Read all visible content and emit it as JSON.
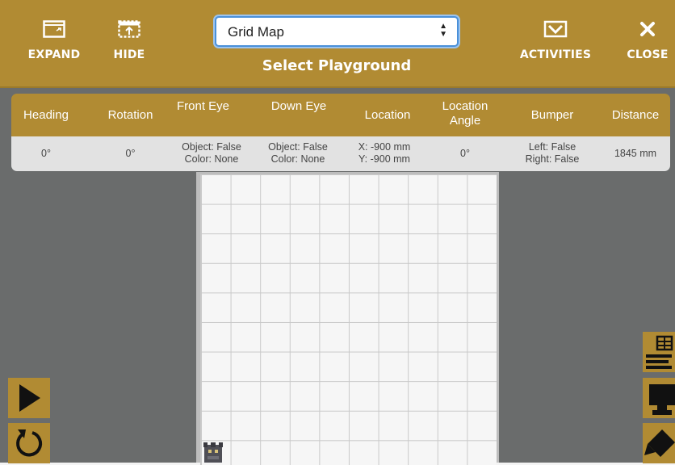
{
  "toolbar": {
    "expand_label": "EXPAND",
    "hide_label": "HIDE",
    "activities_label": "ACTIVITIES",
    "close_label": "CLOSE",
    "title": "Select Playground",
    "playground_select": {
      "value": "Grid Map"
    }
  },
  "sensors": {
    "headers": {
      "heading": "Heading",
      "rotation": "Rotation",
      "front_eye": "Front Eye",
      "down_eye": "Down Eye",
      "location": "Location",
      "location_angle": "Location Angle",
      "bumper": "Bumper",
      "distance": "Distance"
    },
    "values": {
      "heading": "0°",
      "rotation": "0°",
      "front_eye_object": "Object: False",
      "front_eye_color": "Color: None",
      "down_eye_object": "Object: False",
      "down_eye_color": "Color: None",
      "location_x": "X: -900 mm",
      "location_y": "Y: -900 mm",
      "location_angle": "0°",
      "bumper_left": "Left: False",
      "bumper_right": "Right: False",
      "distance": "1845 mm"
    }
  },
  "icons": {
    "expand": "expand-icon",
    "hide": "hide-icon",
    "activities": "activities-icon",
    "close": "close-icon",
    "play": "play-icon",
    "reset": "reset-icon",
    "sensor_table": "sensor-table-icon",
    "robot_view": "robot-view-icon",
    "pen": "pen-icon"
  },
  "colors": {
    "toolbar": "#b18b33",
    "workspace": "#6a6c6c",
    "table_row": "#e2e2e2",
    "grid_line": "#c9c9c9"
  }
}
